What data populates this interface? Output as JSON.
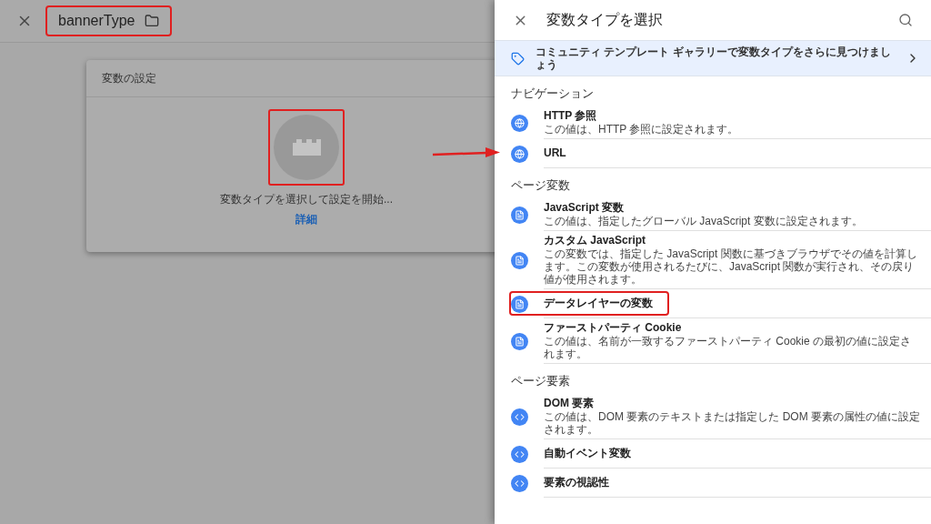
{
  "editor": {
    "name": "bannerType",
    "highlighted": true
  },
  "config_card": {
    "title": "変数の設定",
    "placeholder_highlighted": true,
    "prompt": "変数タイプを選択して設定を開始...",
    "link": "詳細"
  },
  "panel": {
    "title": "変数タイプを選択",
    "banner": "コミュニティ テンプレート ギャラリーで変数タイプをさらに見つけましょう",
    "sections": [
      {
        "heading": "ナビゲーション",
        "kind": "navigation",
        "items": [
          {
            "title": "HTTP 参照",
            "description": "この値は、HTTP 参照に設定されます。",
            "highlighted": false
          },
          {
            "title": "URL",
            "highlighted": false
          }
        ]
      },
      {
        "heading": "ページ変数",
        "kind": "page",
        "items": [
          {
            "title": "JavaScript 変数",
            "description": "この値は、指定したグローバル JavaScript 変数に設定されます。",
            "highlighted": false
          },
          {
            "title": "カスタム JavaScript",
            "description": "この変数では、指定した JavaScript 関数に基づきブラウザでその値を計算します。この変数が使用されるたびに、JavaScript 関数が実行され、その戻り値が使用されます。",
            "highlighted": false
          },
          {
            "title": "データレイヤーの変数",
            "highlighted": true
          },
          {
            "title": "ファーストパーティ Cookie",
            "description": "この値は、名前が一致するファーストパーティ Cookie の最初の値に設定されます。",
            "highlighted": false
          }
        ]
      },
      {
        "heading": "ページ要素",
        "kind": "element",
        "items": [
          {
            "title": "DOM 要素",
            "description": "この値は、DOM 要素のテキストまたは指定した DOM 要素の属性の値に設定されます。",
            "highlighted": false
          },
          {
            "title": "自動イベント変数",
            "highlighted": false
          },
          {
            "title": "要素の視認性",
            "highlighted": false
          }
        ]
      }
    ]
  }
}
